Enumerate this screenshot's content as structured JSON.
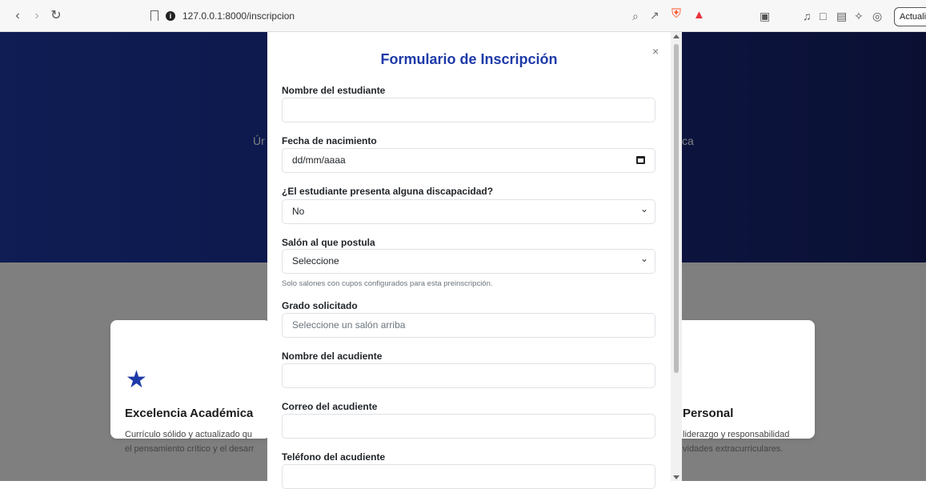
{
  "browser": {
    "url": "127.0.0.1:8000/inscripcion",
    "update_label": "Actualiza"
  },
  "hero": {
    "left_fragment": "Úr",
    "right_fragment": "ca"
  },
  "cards": [
    {
      "title": "Excelencia Académica",
      "line1": "Currículo sólido y actualizado qu",
      "line2": "el pensamiento crítico y el desarr"
    },
    {
      "title": "Personal",
      "line1": "liderazgo y responsabilidad",
      "line2": "vidades extracurriculares."
    }
  ],
  "modal": {
    "title": "Formulario de Inscripción",
    "close": "×",
    "fields": {
      "nombre_estudiante": {
        "label": "Nombre del estudiante",
        "value": ""
      },
      "fecha_nacimiento": {
        "label": "Fecha de nacimiento",
        "value": "dd/mm/aaaa"
      },
      "discapacidad": {
        "label": "¿El estudiante presenta alguna discapacidad?",
        "value": "No"
      },
      "salon": {
        "label": "Salón al que postula",
        "value": "Seleccione",
        "help": "Solo salones con cupos configurados para esta preinscripción."
      },
      "grado": {
        "label": "Grado solicitado",
        "placeholder": "Seleccione un salón arriba"
      },
      "nombre_acudiente": {
        "label": "Nombre del acudiente",
        "value": ""
      },
      "correo_acudiente": {
        "label": "Correo del acudiente",
        "value": ""
      },
      "telefono_acudiente": {
        "label": "Teléfono del acudiente",
        "value": ""
      }
    }
  },
  "colors": {
    "primary": "#1e3aa8",
    "overlay": "#000000"
  }
}
